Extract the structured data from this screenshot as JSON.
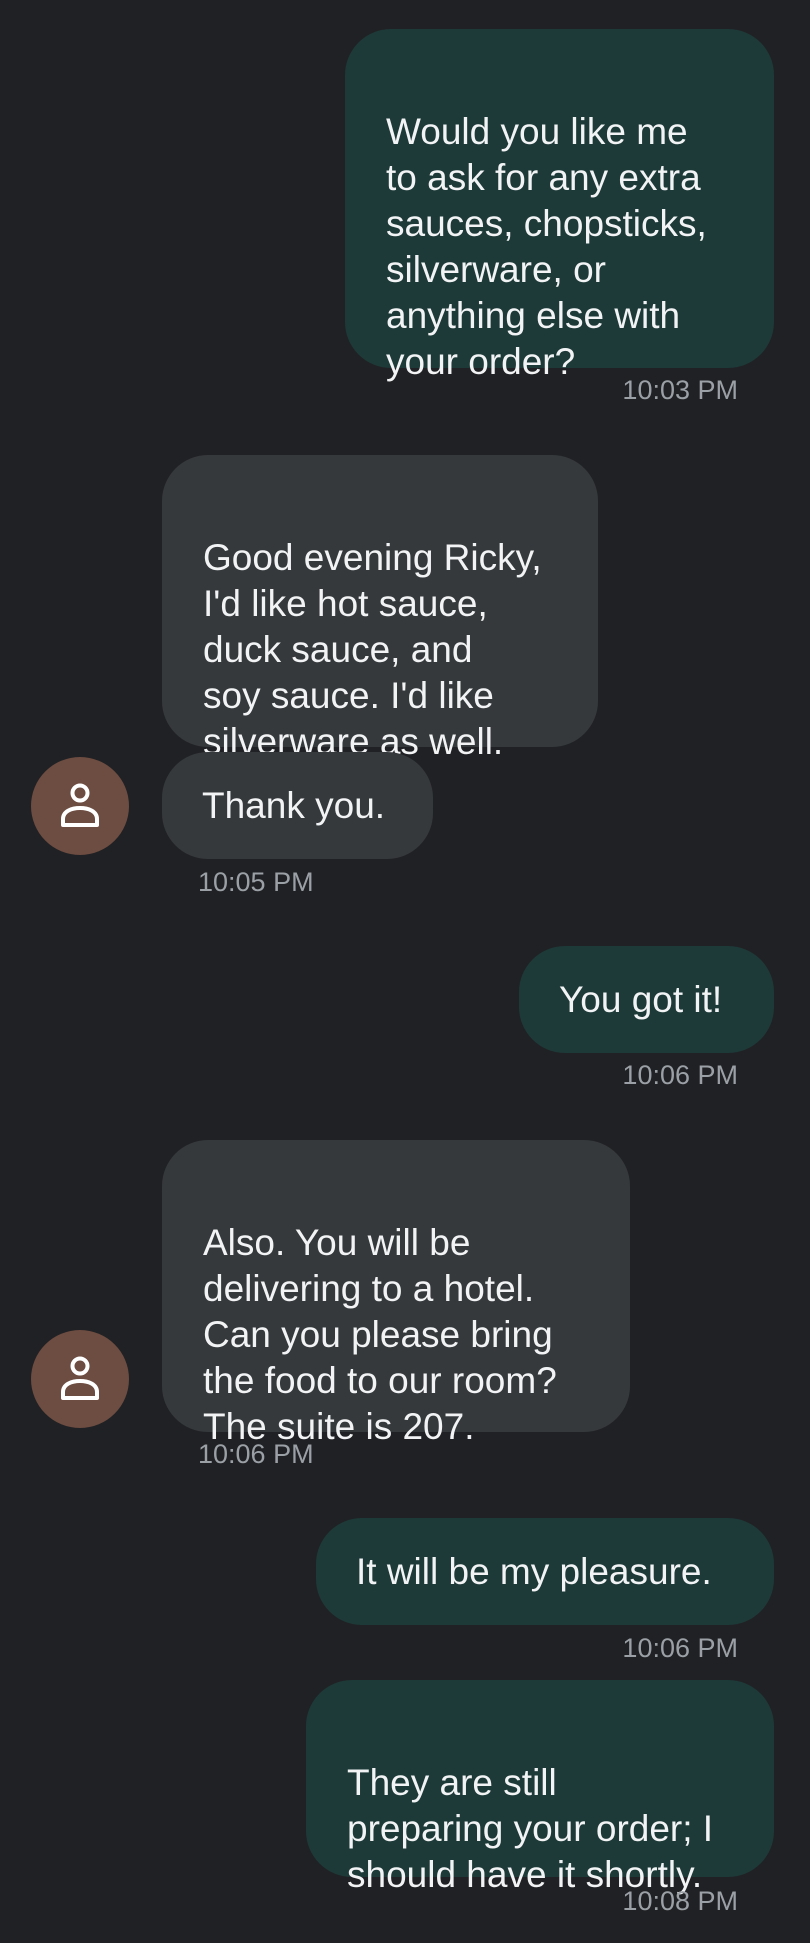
{
  "colors": {
    "background": "#202124",
    "outgoing_bubble": "#1d3a38",
    "incoming_bubble": "#36393c",
    "avatar": "#6d4c41",
    "timestamp": "#9aa0a6"
  },
  "messages": [
    {
      "direction": "outgoing",
      "text": "Would you like me\nto ask for any extra\nsauces, chopsticks,\nsilverware, or\nanything else with\nyour order?",
      "time": "10:03 PM"
    },
    {
      "direction": "incoming",
      "text": "Good evening Ricky,\nI'd like hot sauce,\nduck sauce, and\nsoy sauce. I'd like\nsilverware as well."
    },
    {
      "direction": "incoming",
      "text": "Thank you.",
      "time": "10:05 PM",
      "avatar_icon": "person-icon"
    },
    {
      "direction": "outgoing",
      "text": "You got it!",
      "time": "10:06 PM"
    },
    {
      "direction": "incoming",
      "text": "Also. You will be\ndelivering to a hotel.\nCan you please bring\nthe food to our room?\nThe suite is 207.",
      "time": "10:06 PM",
      "avatar_icon": "person-icon"
    },
    {
      "direction": "outgoing",
      "text": "It will be my pleasure.",
      "time": "10:06 PM"
    },
    {
      "direction": "outgoing",
      "text": "They are still\npreparing your order; I\nshould have it shortly.",
      "time": "10:08 PM"
    }
  ]
}
